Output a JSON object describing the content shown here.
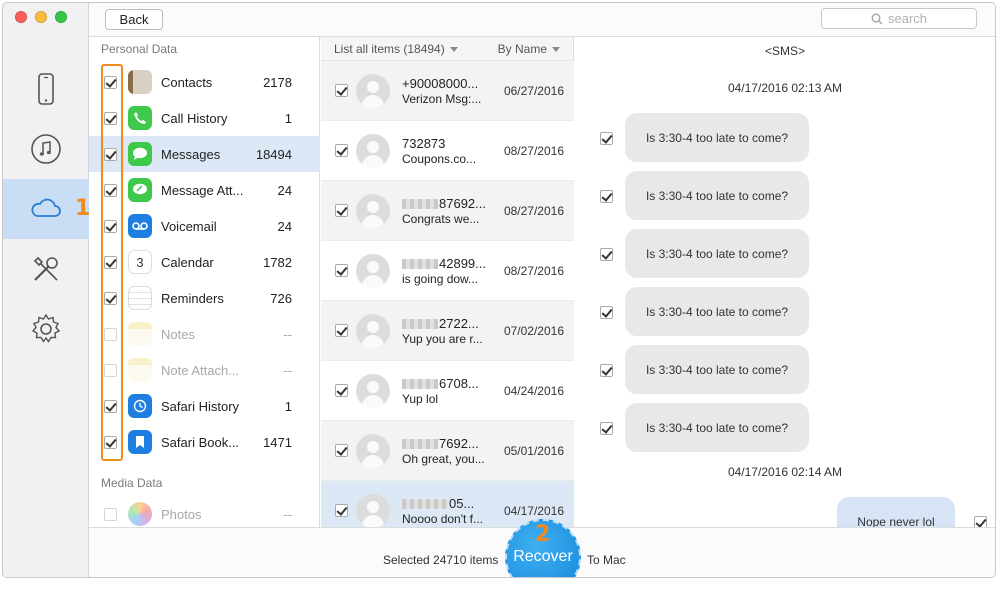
{
  "topbar": {
    "back_label": "Back",
    "search_placeholder": "search"
  },
  "rail": {
    "items": [
      "phone-icon",
      "music-icon",
      "icloud-icon",
      "tools-icon",
      "settings-icon"
    ],
    "step1": "1"
  },
  "categories": {
    "personal_header": "Personal Data",
    "media_header": "Media Data",
    "items": [
      {
        "label": "Contacts",
        "count": "2178",
        "checked": true
      },
      {
        "label": "Call History",
        "count": "1",
        "checked": true
      },
      {
        "label": "Messages",
        "count": "18494",
        "checked": true
      },
      {
        "label": "Message Att...",
        "count": "24",
        "checked": true
      },
      {
        "label": "Voicemail",
        "count": "24",
        "checked": true
      },
      {
        "label": "Calendar",
        "count": "1782",
        "checked": true
      },
      {
        "label": "Reminders",
        "count": "726",
        "checked": true
      },
      {
        "label": "Notes",
        "count": "--",
        "checked": false
      },
      {
        "label": "Note Attach...",
        "count": "--",
        "checked": false
      },
      {
        "label": "Safari History",
        "count": "1",
        "checked": true
      },
      {
        "label": "Safari Book...",
        "count": "1471",
        "checked": true
      }
    ],
    "media_items": [
      {
        "label": "Photos",
        "count": "--",
        "checked": false
      }
    ]
  },
  "list": {
    "header_all": "List all items (18494)",
    "header_sort": "By Name",
    "rows": [
      {
        "title": "+90008000...",
        "sub": "Verizon Msg:...",
        "date": "06/27/2016"
      },
      {
        "title": "732873",
        "sub": "Coupons.co...",
        "date": "08/27/2016"
      },
      {
        "title": "87692...",
        "sub": "Congrats we...",
        "date": "08/27/2016"
      },
      {
        "title": "42899...",
        "sub": "is going dow...",
        "date": "08/27/2016"
      },
      {
        "title": "2722...",
        "sub": "Yup you are r...",
        "date": "07/02/2016"
      },
      {
        "title": "6708...",
        "sub": "Yup lol",
        "date": "04/24/2016"
      },
      {
        "title": "7692...",
        "sub": "Oh great, you...",
        "date": "05/01/2016"
      },
      {
        "title": "05...",
        "sub": "Noooo don't f...",
        "date": "04/17/2016"
      }
    ]
  },
  "detail": {
    "header": "<SMS>",
    "time1": "04/17/2016 02:13 AM",
    "bubbles": [
      "Is 3:30-4 too late to come?",
      "Is 3:30-4 too late to come?",
      "Is 3:30-4 too late to come?",
      "Is 3:30-4 too late to come?",
      "Is 3:30-4 too late to come?",
      "Is 3:30-4 too late to come?"
    ],
    "time2": "04/17/2016 02:14 AM",
    "reply": "Nope never lol"
  },
  "bottom": {
    "selected_text": "Selected 24710 items",
    "recover_label": "Recover",
    "to_mac": "To Mac",
    "step2": "2"
  },
  "colors": {
    "accent": "#1687d8",
    "highlight": "#f08a1c",
    "selection": "#dce8f6"
  }
}
